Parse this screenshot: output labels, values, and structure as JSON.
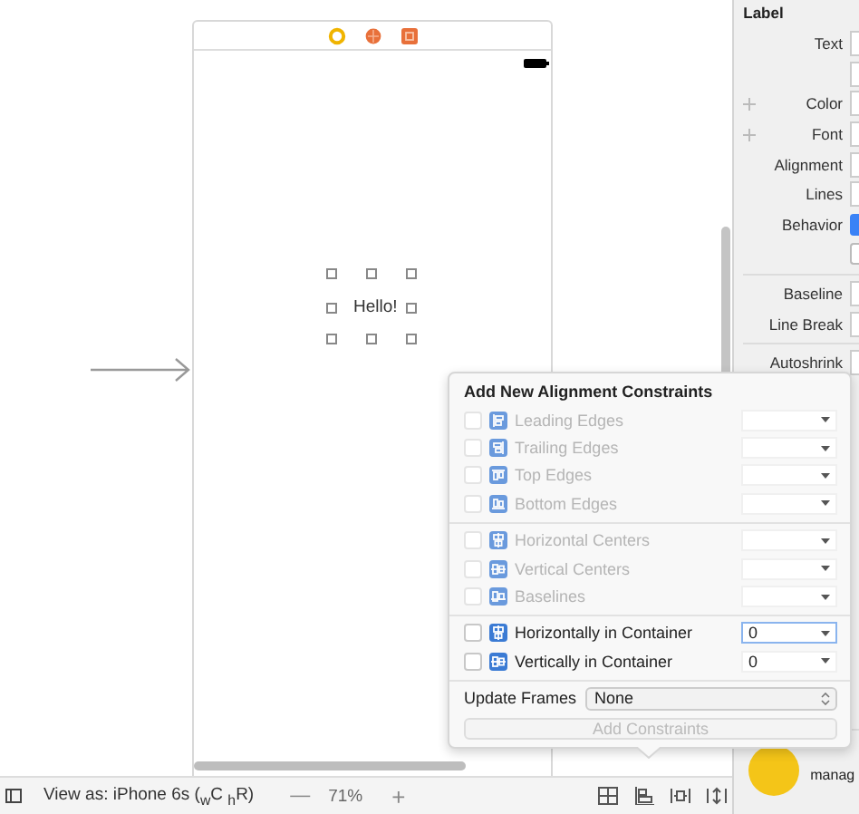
{
  "canvas": {
    "label_text": "Hello!"
  },
  "popover": {
    "title": "Add New Alignment Constraints",
    "groups": [
      [
        {
          "kind": "leading",
          "label": "Leading Edges",
          "enabled": false,
          "checked": false,
          "focused": false
        },
        {
          "kind": "trailing",
          "label": "Trailing Edges",
          "enabled": false,
          "checked": false,
          "focused": false
        },
        {
          "kind": "top",
          "label": "Top Edges",
          "enabled": false,
          "checked": false,
          "focused": false
        },
        {
          "kind": "bottom",
          "label": "Bottom Edges",
          "enabled": false,
          "checked": false,
          "focused": false
        }
      ],
      [
        {
          "kind": "hcenter",
          "label": "Horizontal Centers",
          "enabled": false,
          "checked": false,
          "focused": false
        },
        {
          "kind": "vcenter",
          "label": "Vertical Centers",
          "enabled": false,
          "checked": false,
          "focused": false
        },
        {
          "kind": "baseline",
          "label": "Baselines",
          "enabled": false,
          "checked": false,
          "focused": false
        }
      ],
      [
        {
          "kind": "hcenter",
          "label": "Horizontally in Container",
          "enabled": true,
          "checked": false,
          "focused": true,
          "value": "0"
        },
        {
          "kind": "vcenter",
          "label": "Vertically in Container",
          "enabled": true,
          "checked": false,
          "focused": false,
          "value": "0"
        }
      ]
    ],
    "update_frames": {
      "label": "Update Frames",
      "value": "None"
    },
    "add_button": {
      "label": "Add Constraints",
      "disabled": true
    }
  },
  "inspector": {
    "section": "Label",
    "rows": [
      {
        "kind": "field",
        "label": "Text"
      },
      {
        "kind": "blank"
      },
      {
        "kind": "plus",
        "label": "Color"
      },
      {
        "kind": "plus",
        "label": "Font"
      },
      {
        "kind": "field",
        "label": "Alignment"
      },
      {
        "kind": "field",
        "label": "Lines"
      },
      {
        "kind": "check",
        "label": "Behavior",
        "checked": true
      },
      {
        "kind": "check",
        "checked": false
      },
      {
        "kind": "divider"
      },
      {
        "kind": "field",
        "label": "Baseline"
      },
      {
        "kind": "field",
        "label": "Line Break"
      },
      {
        "kind": "divider"
      },
      {
        "kind": "field",
        "label": "Autoshrink"
      }
    ],
    "object_text": "manag"
  },
  "bottom_bar": {
    "view_as": "View as: iPhone 6s ($_{w}$C $_{h}$R)",
    "zoom_out": "—",
    "zoom": "71%",
    "zoom_in": "+"
  }
}
